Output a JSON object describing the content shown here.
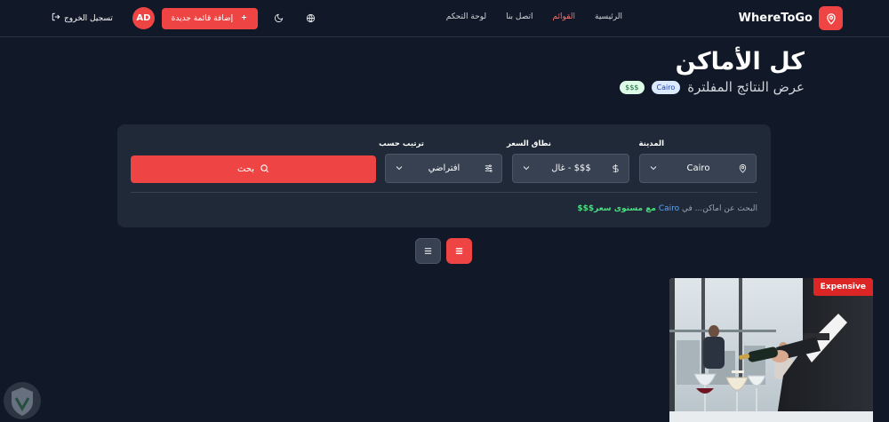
{
  "nav": {
    "brand": "WhereToGo",
    "links": [
      {
        "label": "الرئيسية",
        "active": false
      },
      {
        "label": "القوائم",
        "active": true
      },
      {
        "label": "اتصل بنا",
        "active": false
      },
      {
        "label": "لوحة التحكم",
        "active": false
      }
    ],
    "logout_label": "تسجيل الخروج",
    "avatar_initials": "AD",
    "add_listing_label": "إضافة قائمة جديدة",
    "add_icon": "plus-icon",
    "theme_icon": "moon-icon",
    "language_icon": "globe-icon",
    "logout_icon": "logout-icon"
  },
  "heading": {
    "title": "كل الأماكن",
    "subtitle": "عرض النتائج المفلترة",
    "chips": {
      "city": "Cairo",
      "price": "$$$"
    }
  },
  "filters": {
    "city": {
      "label": "المدينة",
      "value": "Cairo",
      "icon": "map-pin-icon"
    },
    "price": {
      "label": "نطاق السعر",
      "value": "$$$ - غال",
      "icon": "dollar-icon"
    },
    "sort": {
      "label": "ترتيب حسب",
      "value": "افتراضي",
      "icon": "sliders-icon"
    },
    "search_label": "بحث"
  },
  "summary": {
    "prefix": "البحث عن اماكن... في",
    "city": "Cairo",
    "price": "مع مستوى سعر$$$"
  },
  "card": {
    "badge": "Expensive"
  },
  "colors": {
    "background": "#111827",
    "panel": "#1f2937",
    "accent": "#ef4444"
  }
}
